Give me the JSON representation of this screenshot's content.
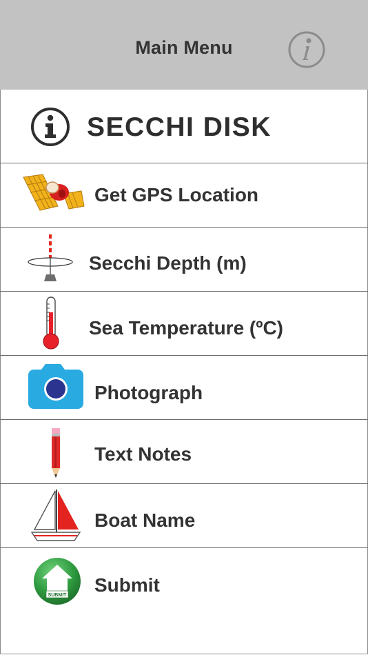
{
  "header": {
    "title": "Main Menu",
    "info_icon": "info-italic-icon"
  },
  "brand": {
    "title": "SECCHI DISK",
    "icon": "info-circle-icon"
  },
  "menu": {
    "items": [
      {
        "label": "Get GPS Location",
        "icon": "satellite-icon"
      },
      {
        "label": "Secchi Depth (m)",
        "icon": "secchi-disk-icon"
      },
      {
        "label": "Sea Temperature (ºC)",
        "icon": "thermometer-icon"
      },
      {
        "label": "Photograph",
        "icon": "camera-icon"
      },
      {
        "label": "Text Notes",
        "icon": "pencil-icon"
      },
      {
        "label": "Boat Name",
        "icon": "sailboat-icon"
      },
      {
        "label": "Submit",
        "icon": "submit-icon",
        "icon_text": "SUBMIT"
      }
    ]
  },
  "colors": {
    "header_bg": "#c2c2c2",
    "text": "#333333",
    "camera_blue": "#29aae1",
    "submit_green": "#2e9a3f",
    "thermometer_red": "#e8202a"
  }
}
